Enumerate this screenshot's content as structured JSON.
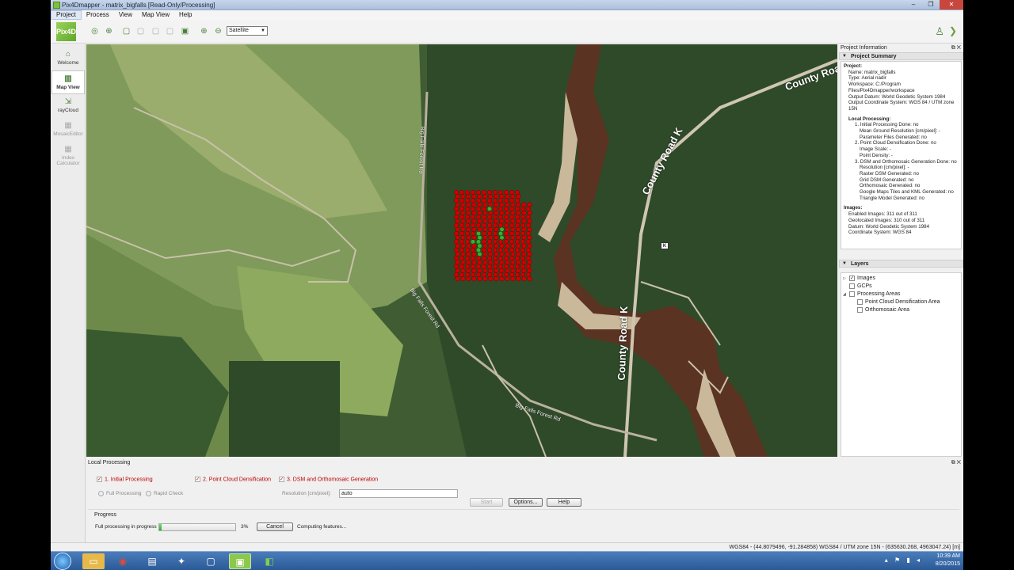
{
  "window": {
    "title": "Pix4Dmapper - matrix_bigfalls [Read-Only/Processing]",
    "controls": [
      "–",
      "❐",
      "✕"
    ]
  },
  "menu": [
    "Project",
    "Process",
    "View",
    "Map View",
    "Help"
  ],
  "toolbar": {
    "logo": "Pix4D",
    "basemap_select": "Satellite"
  },
  "sidebar": [
    {
      "label": "Welcome",
      "icon": "home-icon"
    },
    {
      "label": "Map View",
      "icon": "map-icon"
    },
    {
      "label": "rayCloud",
      "icon": "raycloud-icon"
    },
    {
      "label": "MosaicEditor",
      "icon": "mosaic-icon"
    },
    {
      "label": "Index Calculator",
      "icon": "index-icon"
    }
  ],
  "map": {
    "labels": [
      "County Road",
      "County Road K",
      "County Road K"
    ],
    "small_labels": [
      "Big Falls Forest Rd",
      "Big Falls Forest Rd",
      "Big Falls Forest Rd"
    ],
    "shield": "K",
    "flight_point_color": "#d10000",
    "calibrated_point_color": "#2fb52f"
  },
  "project_info": {
    "panel_title": "Project Information",
    "section_title": "Project Summary",
    "project_heading": "Project:",
    "name": "Name: matrix_bigfalls",
    "type": "Type: Aerial nadir",
    "workspace": "Workspace: C:/Program Files/Pix4Dmapper/workspace",
    "output_datum": "Output Datum: World Geodetic System 1984",
    "output_cs": "Output Coordinate System: WGS 84 / UTM zone 15N",
    "local_heading": "Local Processing:",
    "s1": "1. Initial Processing Done: no",
    "s1a": "Mean Ground Resolution [cm/pixel]: -",
    "s1b": "Parameter Files Generated: no",
    "s2": "2. Point Cloud Densification Done: no",
    "s2a": "Image Scale: -",
    "s2b": "Point Density: -",
    "s3": "3. DSM and Orthomosaic Generation Done: no",
    "s3a": "Resolution [cm/pixel]: -",
    "s3b": "Raster DSM Generated: no",
    "s3c": "Grid DSM Generated: no",
    "s3d": "Orthomosaic Generated: no",
    "s3e": "Google Maps Tiles and KML Generated: no",
    "s3f": "Triangle Model Generated: no",
    "images_heading": "Images:",
    "img1": "Enabled Images: 311 out of 311",
    "img2": "Geolocated Images: 310 out of 311",
    "img3": "Datum: World Geodetic System 1984",
    "img4": "Coordinate System: WGS 84"
  },
  "layers": {
    "title": "Layers",
    "items": [
      "Images",
      "GCPs",
      "Processing Areas",
      "Point Cloud Densification Area",
      "Orthomosaic Area"
    ]
  },
  "local_processing": {
    "title": "Local Processing",
    "step1": "1. Initial Processing",
    "step2": "2. Point Cloud Densification",
    "step3": "3. DSM and Orthomosaic Generation",
    "full_processing": "Full Processing",
    "rapid_check": "Rapid Check",
    "resolution_label": "Resolution [cm/pixel]:",
    "resolution_value": "auto",
    "start": "Start",
    "options": "Options...",
    "help": "Help",
    "progress_title": "Progress",
    "progress_text": "Full processing in progress",
    "progress_value": 3,
    "progress_pct": "3%",
    "cancel": "Cancel",
    "status": "Computing features..."
  },
  "statusbar": "WGS84 - (44.8079496, -91.284858)  WGS84 / UTM zone 15N - (635630.268, 4963047.24) [m]",
  "taskbar": {
    "time": "10:39 AM",
    "date": "8/20/2015"
  }
}
